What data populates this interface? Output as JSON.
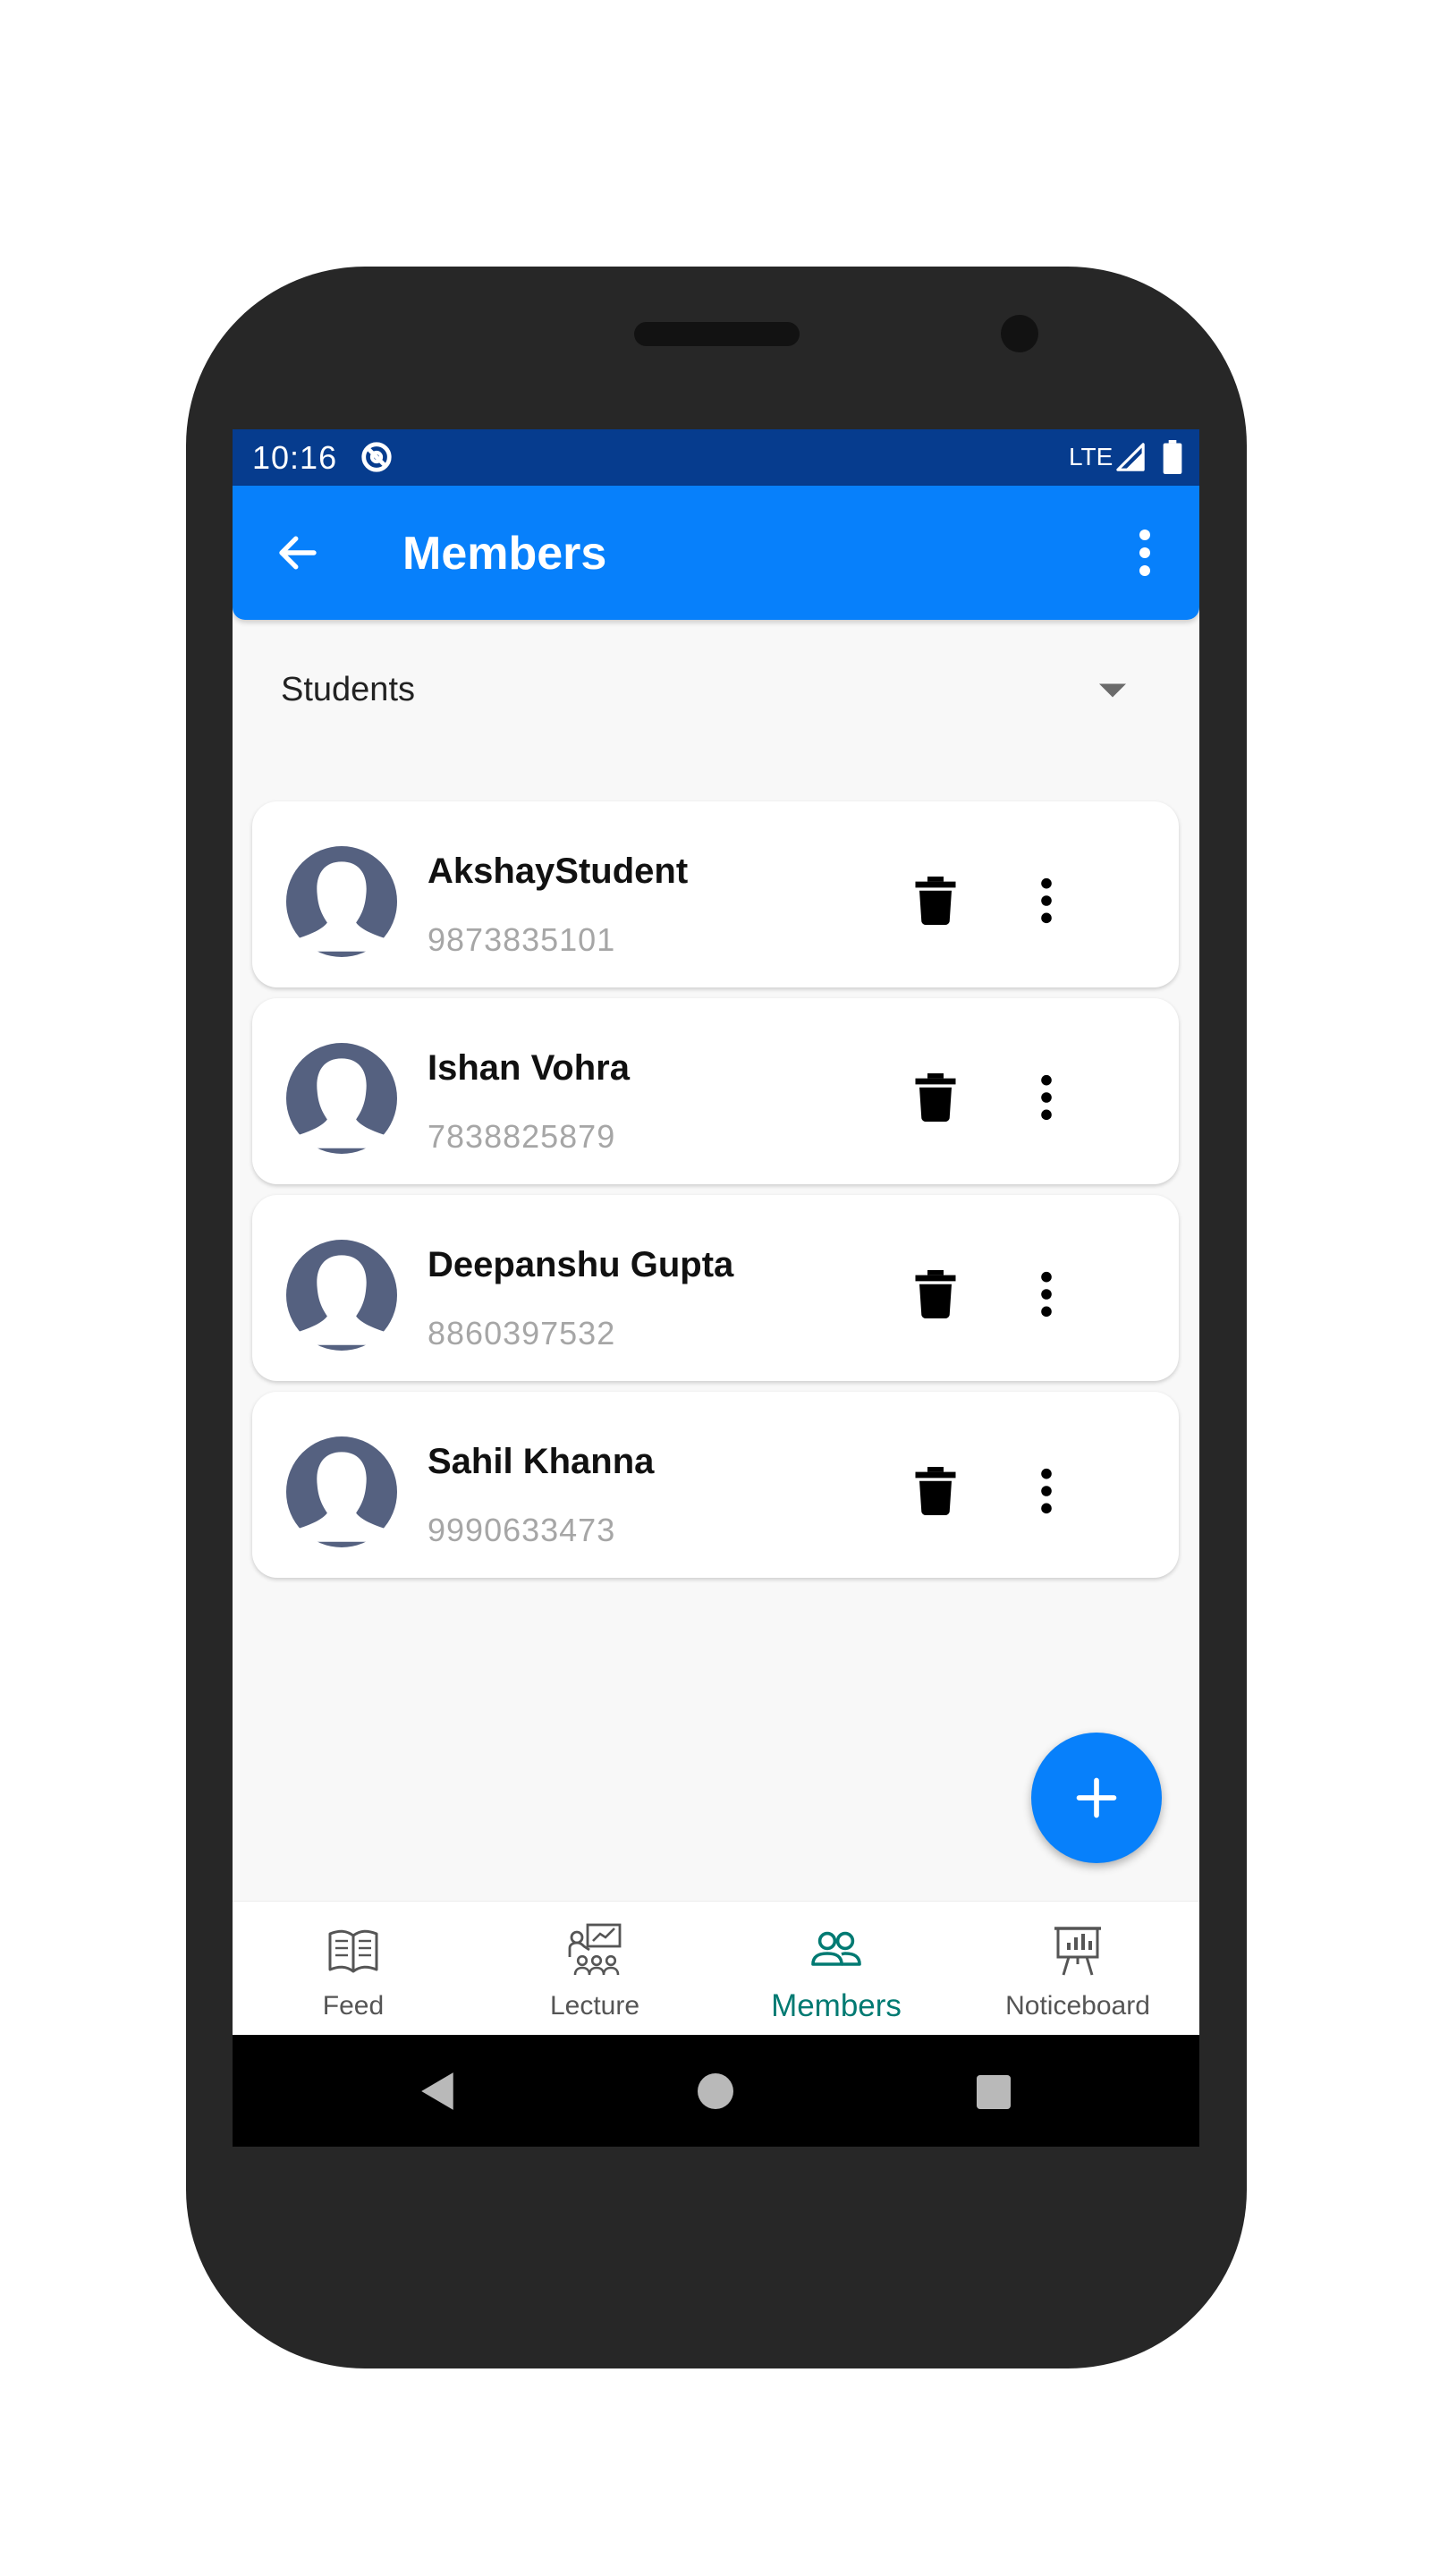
{
  "status_bar": {
    "time": "10:16",
    "network": "LTE"
  },
  "app_bar": {
    "title": "Members"
  },
  "filter": {
    "selected": "Students"
  },
  "members": [
    {
      "name": "AkshayStudent",
      "phone": "9873835101"
    },
    {
      "name": "Ishan Vohra",
      "phone": "7838825879"
    },
    {
      "name": "Deepanshu Gupta",
      "phone": "8860397532"
    },
    {
      "name": "Sahil Khanna",
      "phone": "9990633473"
    }
  ],
  "bottom_nav": [
    {
      "label": "Feed",
      "icon": "book-icon",
      "active": false
    },
    {
      "label": "Lecture",
      "icon": "classroom-icon",
      "active": false
    },
    {
      "label": "Members",
      "icon": "people-icon",
      "active": true
    },
    {
      "label": "Noticeboard",
      "icon": "presentation-board-icon",
      "active": false
    }
  ],
  "colors": {
    "status_bar": "#063c8e",
    "app_bar": "#0780fb",
    "fab": "#0780fb",
    "active_nav": "#007a72",
    "avatar": "#556180",
    "phone_number": "#a6a6a6"
  }
}
